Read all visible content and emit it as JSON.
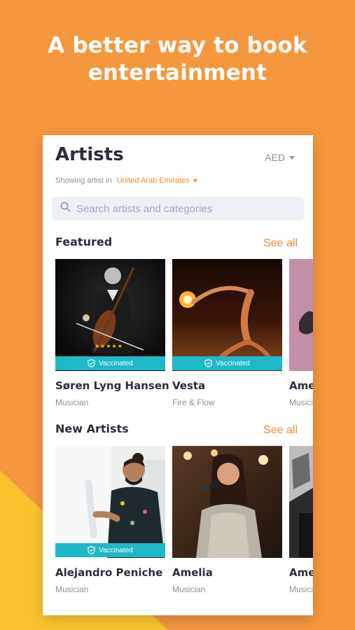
{
  "headline": {
    "line1": "A better way to book",
    "line2": "entertainment"
  },
  "header": {
    "title": "Artists",
    "currency": "AED",
    "location_prefix": "Showing artist in",
    "location_country": "United Arab Emirates"
  },
  "search": {
    "placeholder": "Search artists and categories"
  },
  "featured": {
    "title": "Featured",
    "see_all": "See all",
    "artists": [
      {
        "name": "Søren Lyng Hansen",
        "category": "Musician",
        "badge": "Vaccinated",
        "rating": "★★★★★"
      },
      {
        "name": "Vesta",
        "category": "Fire & Flow",
        "badge": "Vaccinated"
      },
      {
        "name": "Ame",
        "category": "Musici"
      }
    ]
  },
  "new_artists": {
    "title": "New Artists",
    "see_all": "See all",
    "artists": [
      {
        "name": "Alejandro Peniche",
        "category": "Musician",
        "badge": "Vaccinated"
      },
      {
        "name": "Amelia",
        "category": "Musician"
      },
      {
        "name": "Ame",
        "category": "Musici"
      }
    ]
  },
  "colors": {
    "background": "#F5973E",
    "accent": "#F08A34",
    "badge": "#1EB9C8",
    "text": "#2B2E3A",
    "muted": "#8A8F9C"
  }
}
